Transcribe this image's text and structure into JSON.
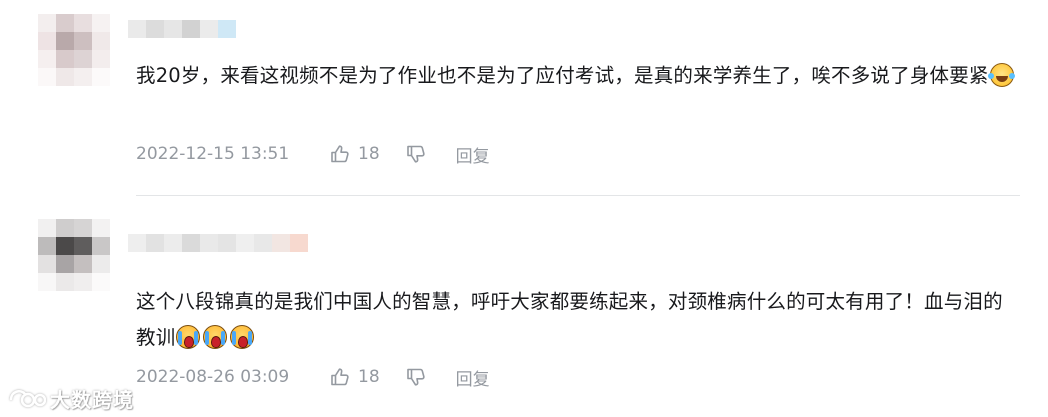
{
  "comments": [
    {
      "text": "我20岁，来看这视频不是为了作业也不是为了应付考试，是真的来学养生了，唉不多说了身体要紧",
      "emoji_icon": "laugh-cry-emoji-icon",
      "time": "2022-12-15 13:51",
      "likes": "18",
      "reply_label": "回复"
    },
    {
      "text": "这个八段锦真的是我们中国人的智慧，呼吁大家都要练起来，对颈椎病什么的可太有用了！血与泪的教训",
      "emoji_icon": "wailing-emoji-icon",
      "time": "2022-08-26 03:09",
      "likes": "18",
      "reply_label": "回复"
    }
  ],
  "watermark": {
    "text": "大数跨境"
  },
  "colors": {
    "meta_gray": "#9499a0",
    "text": "#18191c",
    "divider": "#e3e5e7"
  }
}
